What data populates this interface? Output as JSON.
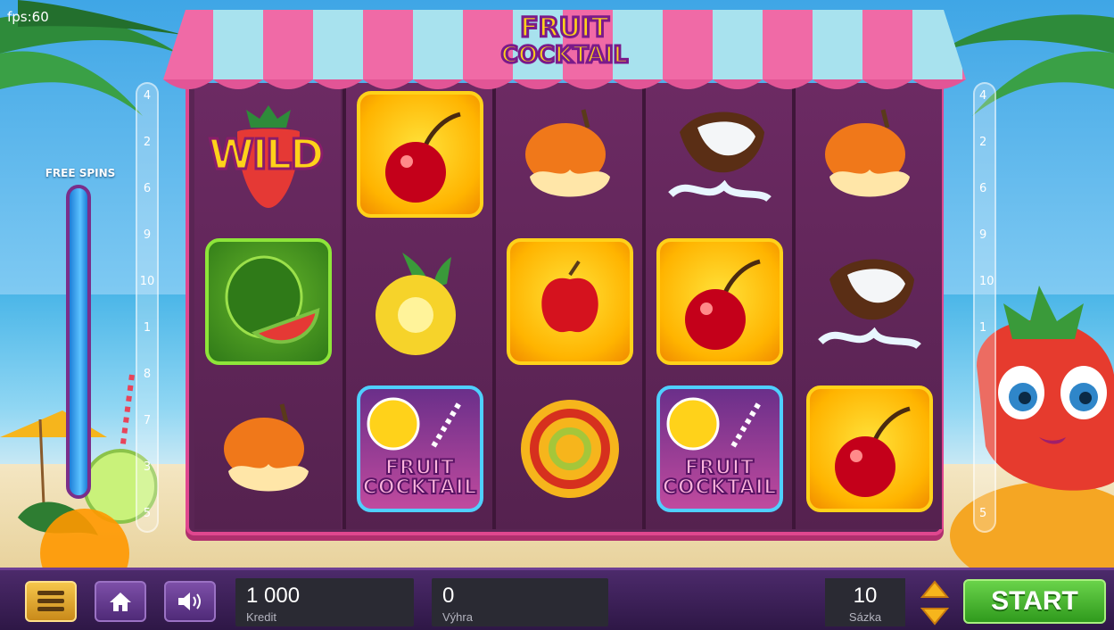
{
  "fps": "fps:60",
  "game": {
    "title_line1": "FRUIT",
    "title_line2": "COCKTAIL"
  },
  "free_spins": {
    "label": "FREE SPINS",
    "level": 0.95
  },
  "paylines_left": [
    "4",
    "2",
    "6",
    "9",
    "10",
    "1",
    "8",
    "7",
    "3",
    "5"
  ],
  "paylines_right": [
    "4",
    "2",
    "6",
    "9",
    "10",
    "1",
    "8",
    "7",
    "3",
    "5"
  ],
  "reels": [
    [
      "wild",
      "cherry",
      "pear",
      "coconut",
      "pear"
    ],
    [
      "watermelon",
      "pineapple",
      "apple",
      "cherry",
      "coconut"
    ],
    [
      "pear",
      "cocktail",
      "orange-swirl",
      "cocktail",
      "cherry"
    ]
  ],
  "symbols": {
    "wild_text": "WILD",
    "cocktail_line1": "FRUIT",
    "cocktail_line2": "COCKTAIL"
  },
  "bottom_bar": {
    "credit_value": "1 000",
    "credit_label": "Kredit",
    "win_value": "0",
    "win_label": "Výhra",
    "bet_value": "10",
    "bet_label": "Sázka",
    "start_label": "START"
  },
  "colors": {
    "accent_pink": "#e0478f",
    "reel_bg": "#5a2554",
    "start_green": "#2f9a1d",
    "menu_gold": "#f6c64b"
  }
}
